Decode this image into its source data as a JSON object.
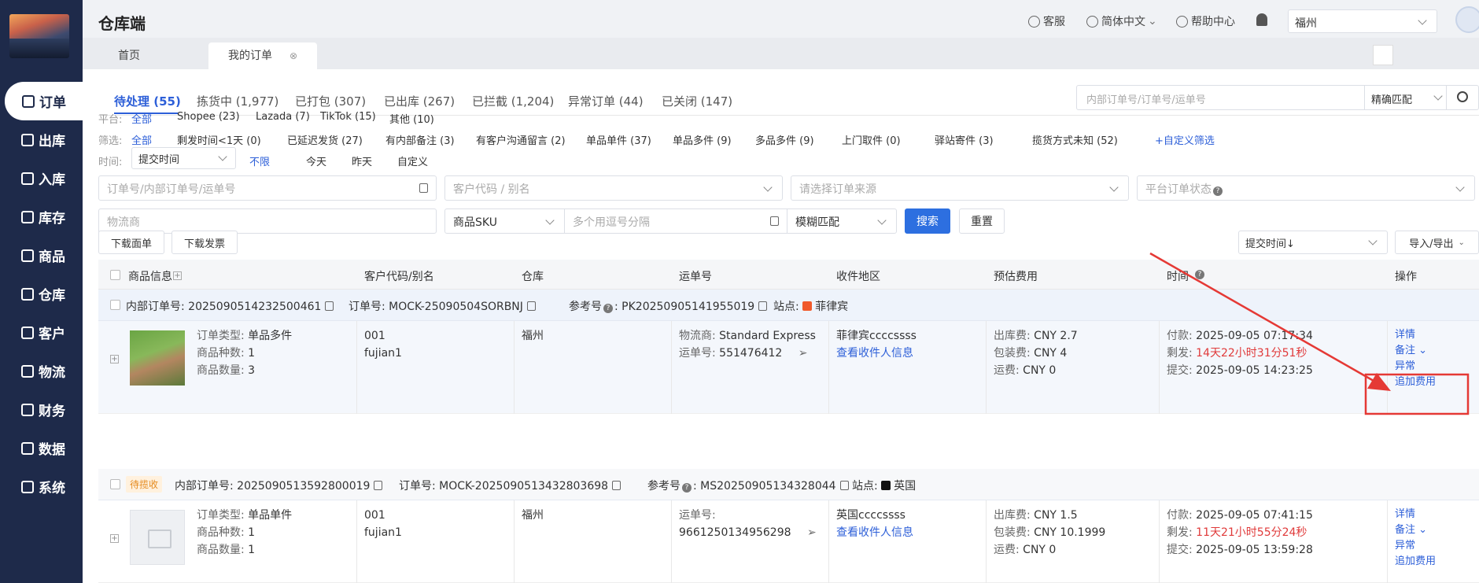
{
  "app": {
    "title": "仓库端"
  },
  "header": {
    "service": "客服",
    "language": "简体中文",
    "help": "帮助中心",
    "city": "福州"
  },
  "sidebar": {
    "items": [
      {
        "label": "订单",
        "icon": "order-icon"
      },
      {
        "label": "出库",
        "icon": "outbound-icon"
      },
      {
        "label": "入库",
        "icon": "inbound-icon"
      },
      {
        "label": "库存",
        "icon": "inventory-icon"
      },
      {
        "label": "商品",
        "icon": "product-icon"
      },
      {
        "label": "仓库",
        "icon": "warehouse-icon"
      },
      {
        "label": "客户",
        "icon": "customer-icon"
      },
      {
        "label": "物流",
        "icon": "logistics-icon"
      },
      {
        "label": "财务",
        "icon": "finance-icon"
      },
      {
        "label": "数据",
        "icon": "data-icon"
      },
      {
        "label": "系统",
        "icon": "system-icon"
      }
    ]
  },
  "tabs": [
    {
      "label": "首页"
    },
    {
      "label": "我的订单"
    }
  ],
  "status_tabs": [
    {
      "label": "待处理 (55)"
    },
    {
      "label": "拣货中 (1,977)"
    },
    {
      "label": "已打包 (307)"
    },
    {
      "label": "已出库 (267)"
    },
    {
      "label": "已拦截 (1,204)"
    },
    {
      "label": "异常订单 (44)"
    },
    {
      "label": "已关闭 (147)"
    }
  ],
  "top_search": {
    "placeholder": "内部订单号/订单号/运单号",
    "mode": "精确匹配"
  },
  "platform": {
    "label": "平台:",
    "options": [
      "全部",
      "Shopee (23)",
      "Lazada (7)",
      "TikTok (15)",
      "其他 (10)"
    ]
  },
  "filter": {
    "label": "筛选:",
    "options": [
      "全部",
      "剩发时间<1天 (0)",
      "已延迟发货 (27)",
      "有内部备注 (3)",
      "有客户沟通留言 (2)",
      "单品单件 (37)",
      "单品多件 (9)",
      "多品多件 (9)",
      "上门取件 (0)",
      "驿站寄件 (3)",
      "揽货方式未知 (52)",
      "+自定义筛选"
    ]
  },
  "time": {
    "label": "时间:",
    "select": "提交时间",
    "options": [
      "不限",
      "今天",
      "昨天",
      "自定义"
    ]
  },
  "form": {
    "order_no_ph": "订单号/内部订单号/运单号",
    "customer_ph": "客户代码 / 别名",
    "source_ph": "请选择订单来源",
    "platform_status_ph": "平台订单状态",
    "logistics_ph": "物流商",
    "sku_select": "商品SKU",
    "sku_ph": "多个用逗号分隔",
    "match": "模糊匹配",
    "search_btn": "搜索",
    "reset_btn": "重置"
  },
  "actions": {
    "download_label": "下载面单",
    "download_invoice": "下载发票",
    "sort": "提交时间↓",
    "import_export": "导入/导出"
  },
  "table": {
    "headers": [
      "商品信息",
      "客户代码/别名",
      "仓库",
      "运单号",
      "收件地区",
      "预估费用",
      "时间",
      "操作"
    ]
  },
  "orders": [
    {
      "internal_label": "内部订单号:",
      "internal_no": "2025090514232500461",
      "order_label": "订单号:",
      "order_no": "MOCK-25090504SORBNJ",
      "ref_label": "参考号",
      "ref_no": "PK20250905141955019",
      "site_label": "站点:",
      "site": "菲律宾",
      "badge": "",
      "type_label": "订单类型:",
      "type": "单品多件",
      "kinds_label": "商品种数:",
      "kinds": "1",
      "qty_label": "商品数量:",
      "qty": "3",
      "customer_code": "001",
      "customer_alias": "fujian1",
      "warehouse": "福州",
      "carrier_label": "物流商:",
      "carrier": "Standard Express",
      "waybill_label": "运单号:",
      "waybill": "551476412",
      "region": "菲律宾ccccssss",
      "view_receiver": "查看收件人信息",
      "fee_out_label": "出库费:",
      "fee_out": "CNY 2.7",
      "fee_pack_label": "包装费:",
      "fee_pack": "CNY 4",
      "fee_ship_label": "运费:",
      "fee_ship": "CNY 0",
      "pay_label": "付款:",
      "pay_time": "2025-09-05 07:17:34",
      "remain_label": "剩发:",
      "remain": "14天22小时31分51秒",
      "submit_label": "提交:",
      "submit_time": "2025-09-05 14:23:25",
      "ops": [
        "详情",
        "备注",
        "异常",
        "追加费用"
      ]
    },
    {
      "internal_label": "内部订单号:",
      "internal_no": "2025090513592800019",
      "order_label": "订单号:",
      "order_no": "MOCK-2025090513432803698",
      "ref_label": "参考号",
      "ref_no": "MS20250905134328044",
      "site_label": "站点:",
      "site": "英国",
      "badge": "待揽收",
      "type_label": "订单类型:",
      "type": "单品单件",
      "kinds_label": "商品种数:",
      "kinds": "1",
      "qty_label": "商品数量:",
      "qty": "1",
      "customer_code": "001",
      "customer_alias": "fujian1",
      "warehouse": "福州",
      "carrier_label": "",
      "carrier": "",
      "waybill_label": "运单号:",
      "waybill": "9661250134956298",
      "region": "英国ccccssss",
      "view_receiver": "查看收件人信息",
      "fee_out_label": "出库费:",
      "fee_out": "CNY 1.5",
      "fee_pack_label": "包装费:",
      "fee_pack": "CNY 10.1999",
      "fee_ship_label": "运费:",
      "fee_ship": "CNY 0",
      "pay_label": "付款:",
      "pay_time": "2025-09-05 07:41:15",
      "remain_label": "剩发:",
      "remain": "11天21小时55分24秒",
      "submit_label": "提交:",
      "submit_time": "2025-09-05 13:59:28",
      "ops": [
        "详情",
        "备注",
        "异常",
        "追加费用"
      ]
    }
  ],
  "colors": {
    "sidebar": "#1e2a4a",
    "primary": "#2d5fd8",
    "alert": "#e03a3a",
    "annotation": "#e53935"
  }
}
